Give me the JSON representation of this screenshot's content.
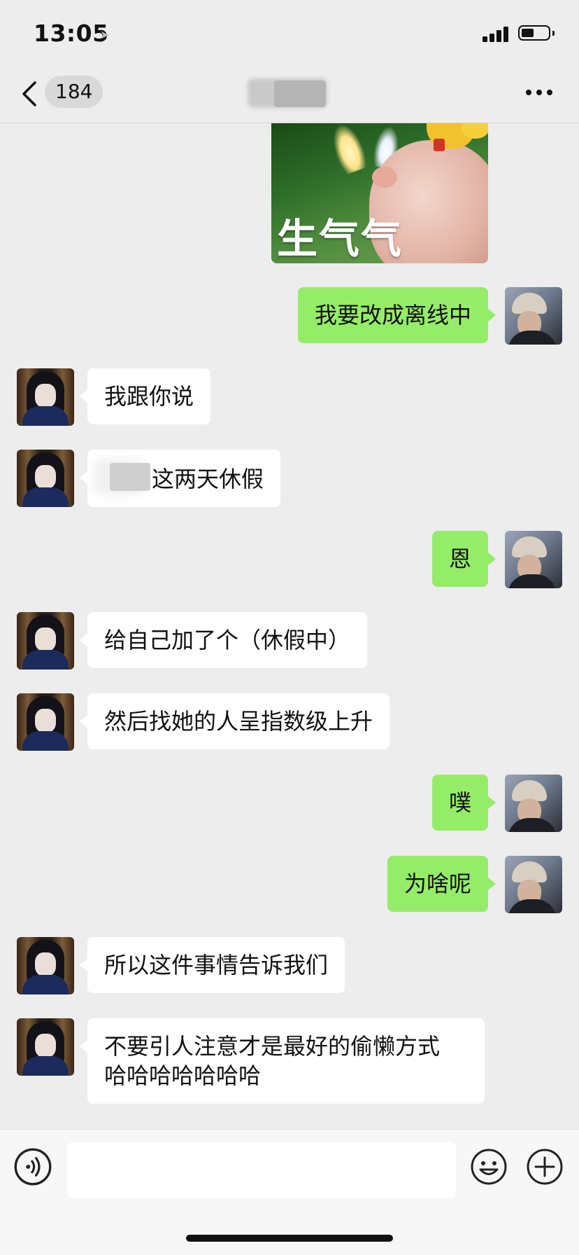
{
  "status_bar": {
    "time": "13:05",
    "icons": [
      "location-arrow-icon",
      "cellular-signal-icon",
      "battery-icon"
    ],
    "battery_level_fraction": 0.5
  },
  "nav": {
    "back_icon": "chevron-left-icon",
    "unread_count": "184",
    "more_icon": "ellipsis-icon"
  },
  "sticker": {
    "caption": "生气气"
  },
  "messages": [
    {
      "side": "right",
      "text": "我要改成离线中"
    },
    {
      "side": "left",
      "text": "我跟你说"
    },
    {
      "side": "left",
      "text": "这两天休假"
    },
    {
      "side": "right",
      "text": "恩"
    },
    {
      "side": "left",
      "text": "给自己加了个（休假中）"
    },
    {
      "side": "left",
      "text": "然后找她的人呈指数级上升"
    },
    {
      "side": "right",
      "text": "噗"
    },
    {
      "side": "right",
      "text": "为啥呢"
    },
    {
      "side": "left",
      "text": "所以这件事情告诉我们"
    },
    {
      "side": "left",
      "lines": [
        "不要引人注意才是最好的偷懒方式",
        "哈哈哈哈哈哈哈"
      ]
    }
  ],
  "input_bar": {
    "voice_icon": "voice-icon",
    "input_value": "",
    "emoji_icon": "emoji-icon",
    "plus_icon": "plus-icon"
  },
  "colors": {
    "background": "#ededed",
    "outgoing_bubble": "#95ec69",
    "incoming_bubble": "#ffffff"
  }
}
